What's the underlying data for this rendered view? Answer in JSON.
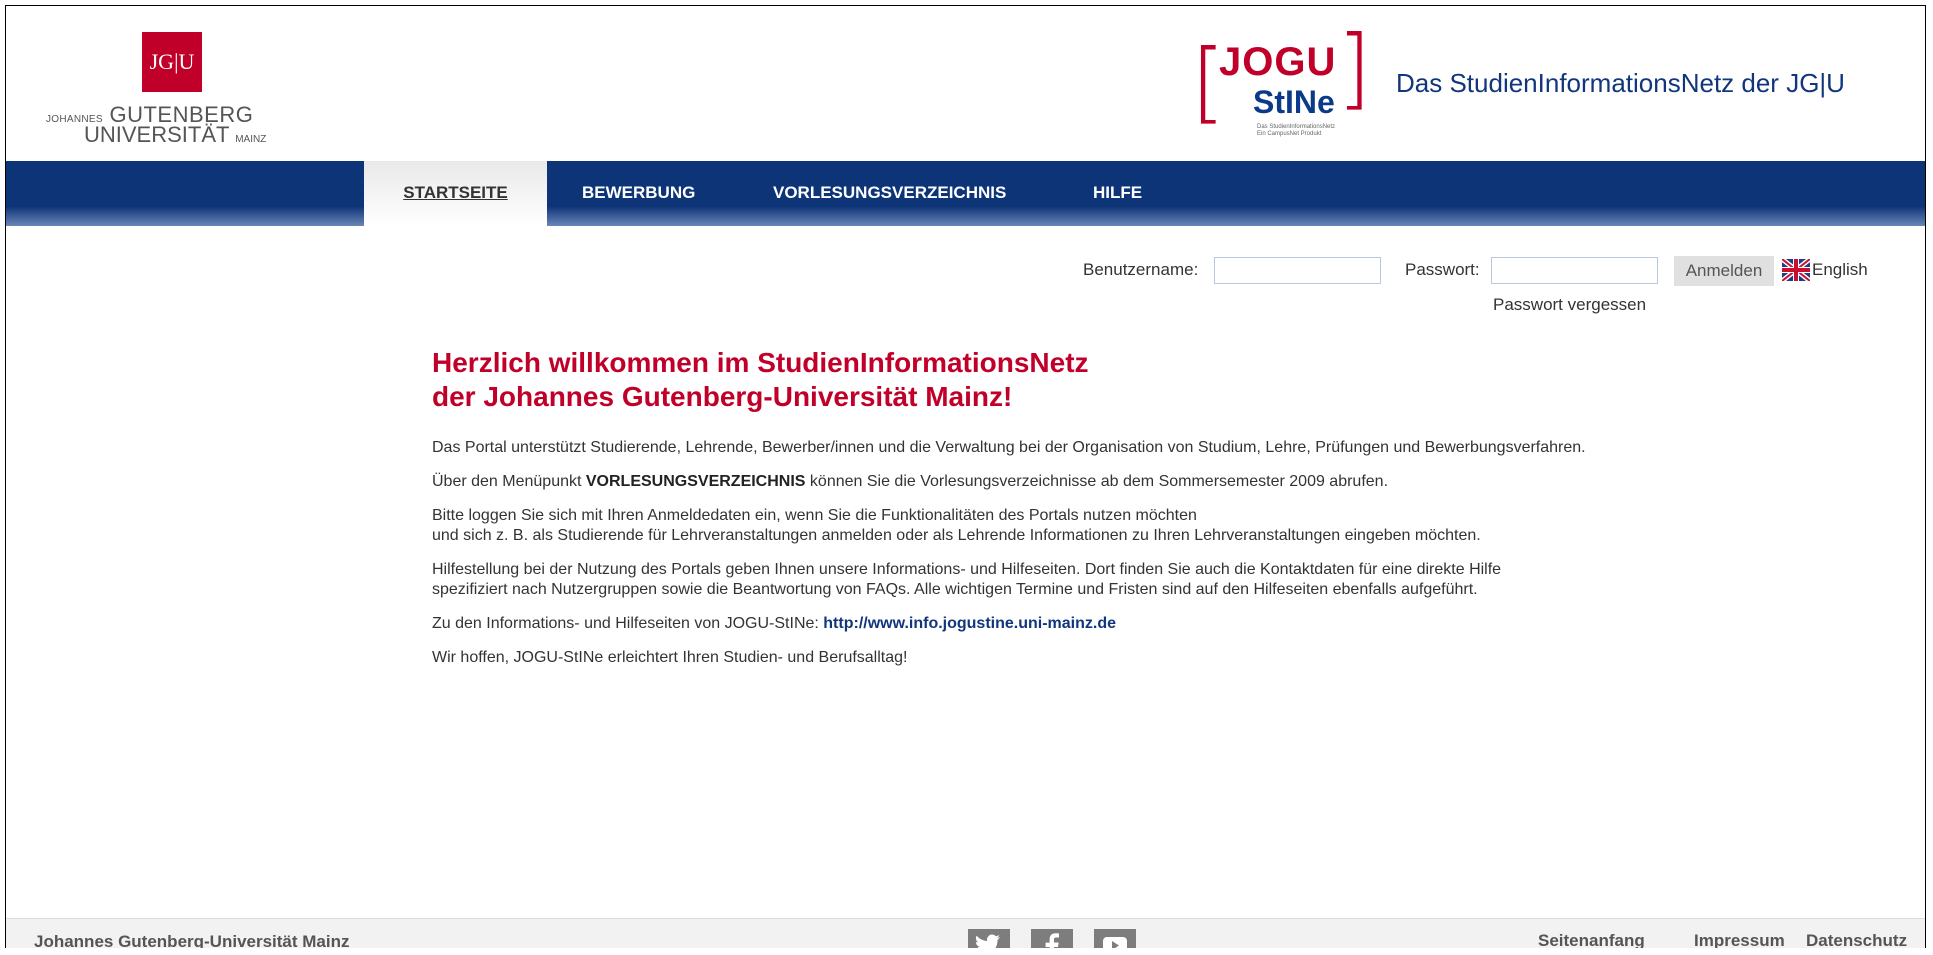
{
  "header": {
    "uni_logo": {
      "mark": "JG|U",
      "line1_small": "JOHANNES",
      "line1": "GUTENBERG",
      "line2": "UNIVERSITÄT",
      "line2_small": "MAINZ"
    },
    "stine_logo": {
      "jogu": "JOGU",
      "stine": "StINe",
      "sub1": "Das StudienInformationsNetz",
      "sub2": "Ein CampusNet Produkt"
    },
    "title": "Das StudienInformationsNetz der JG|U"
  },
  "nav": {
    "items": [
      {
        "label": "STARTSEITE",
        "active": true
      },
      {
        "label": "BEWERBUNG",
        "active": false
      },
      {
        "label": "VORLESUNGSVERZEICHNIS",
        "active": false
      },
      {
        "label": "HILFE",
        "active": false
      }
    ]
  },
  "login": {
    "username_label": "Benutzername:",
    "username_value": "",
    "password_label": "Passwort:",
    "password_value": "",
    "login_button": "Anmelden",
    "language_link": "English",
    "forgot_password": "Passwort vergessen"
  },
  "main": {
    "welcome_line1": "Herzlich willkommen im StudienInformationsNetz",
    "welcome_line2": "der Johannes Gutenberg-Universität Mainz!",
    "para1": "Das Portal unterstützt Studierende, Lehrende, Bewerber/innen und die Verwaltung bei der Organisation von Studium, Lehre, Prüfungen und Bewerbungsverfahren.",
    "para2_pre": "Über den Menüpunkt ",
    "para2_bold": "VORLESUNGSVERZEICHNIS",
    "para2_post": " können Sie die Vorlesungsverzeichnisse ab dem Sommersemester 2009 abrufen.",
    "para3_line1": "Bitte loggen Sie sich mit Ihren Anmeldedaten ein, wenn Sie die Funktionalitäten des Portals nutzen möchten",
    "para3_line2": "und sich z. B. als Studierende für Lehrveranstaltungen anmelden oder als Lehrende Informationen zu Ihren Lehrveranstaltungen eingeben möchten.",
    "para4_line1": "Hilfestellung bei der Nutzung des Portals geben Ihnen unsere Informations- und Hilfeseiten. Dort finden Sie auch die Kontaktdaten für eine direkte Hilfe",
    "para4_line2": "spezifiziert nach Nutzergruppen sowie die Beantwortung von FAQs. Alle wichtigen Termine und Fristen sind auf den Hilfeseiten ebenfalls aufgeführt.",
    "para5_pre": "Zu den Informations- und Hilfeseiten von JOGU-StINe: ",
    "para5_link": "http://www.info.jogustine.uni-mainz.de",
    "para6": "Wir hoffen, JOGU-StINe erleichtert Ihren Studien- und Berufsalltag!"
  },
  "footer": {
    "university": "Johannes Gutenberg-Universität Mainz",
    "social": [
      "twitter-icon",
      "facebook-icon",
      "youtube-icon"
    ],
    "links": [
      "Seitenanfang",
      "Impressum",
      "Datenschutz"
    ]
  },
  "colors": {
    "brand_red": "#c1002a",
    "brand_blue": "#0e3478",
    "link_blue": "#11367d"
  }
}
